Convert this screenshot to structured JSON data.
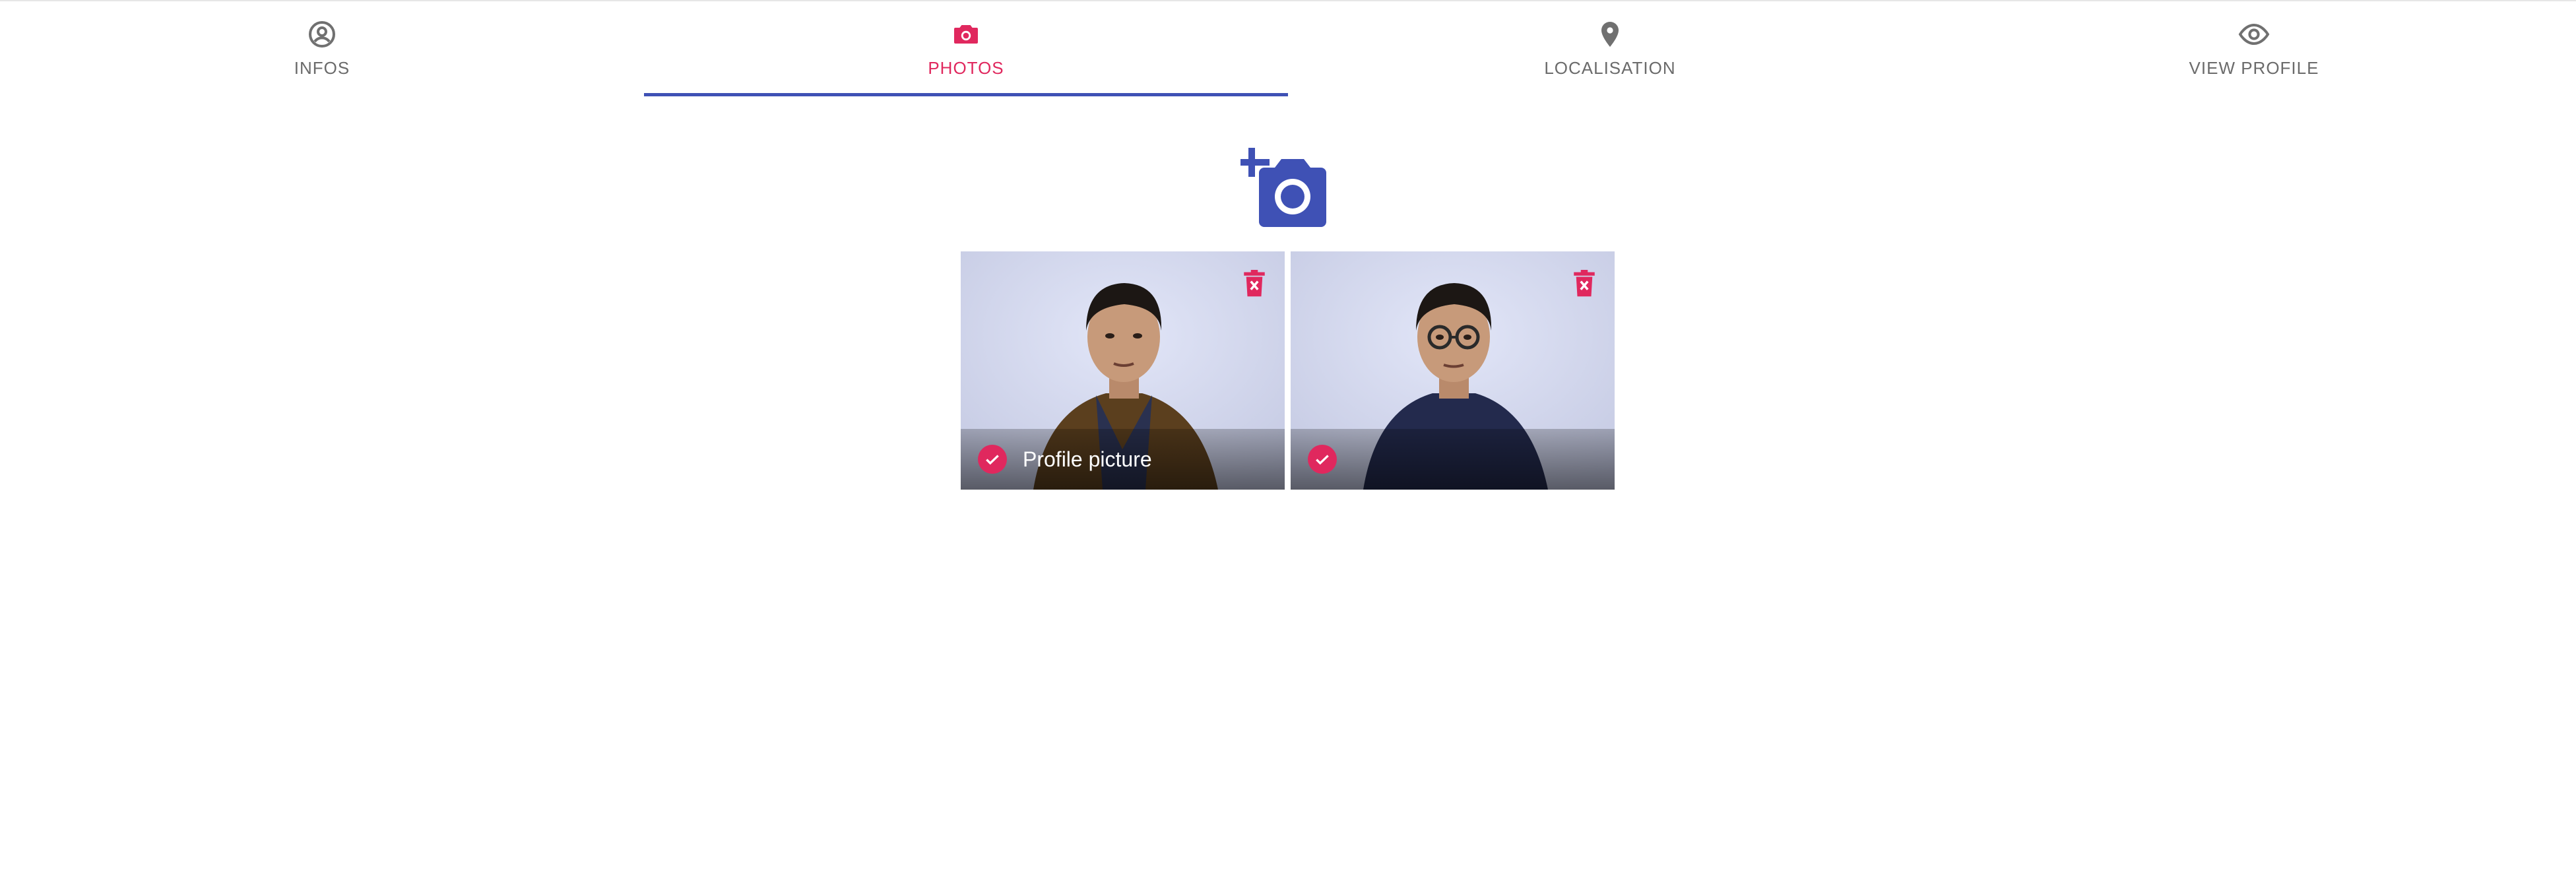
{
  "colors": {
    "accent": "#e0285e",
    "primary": "#3f51b5",
    "tab_inactive": "#6b6b6b"
  },
  "tabs": [
    {
      "label": "INFOS",
      "icon": "account-circle-icon",
      "active": false
    },
    {
      "label": "PHOTOS",
      "icon": "camera-icon",
      "active": true
    },
    {
      "label": "LOCALISATION",
      "icon": "location-pin-icon",
      "active": false
    },
    {
      "label": "VIEW PROFILE",
      "icon": "eye-icon",
      "active": false
    }
  ],
  "upload": {
    "icon": "add-photo-camera-icon"
  },
  "photos": [
    {
      "caption": "Profile picture",
      "selected": true,
      "delete_icon": "delete-icon",
      "subject": "man in brown jacket"
    },
    {
      "caption": "",
      "selected": true,
      "delete_icon": "delete-icon",
      "subject": "man with glasses in navy shirt"
    }
  ]
}
